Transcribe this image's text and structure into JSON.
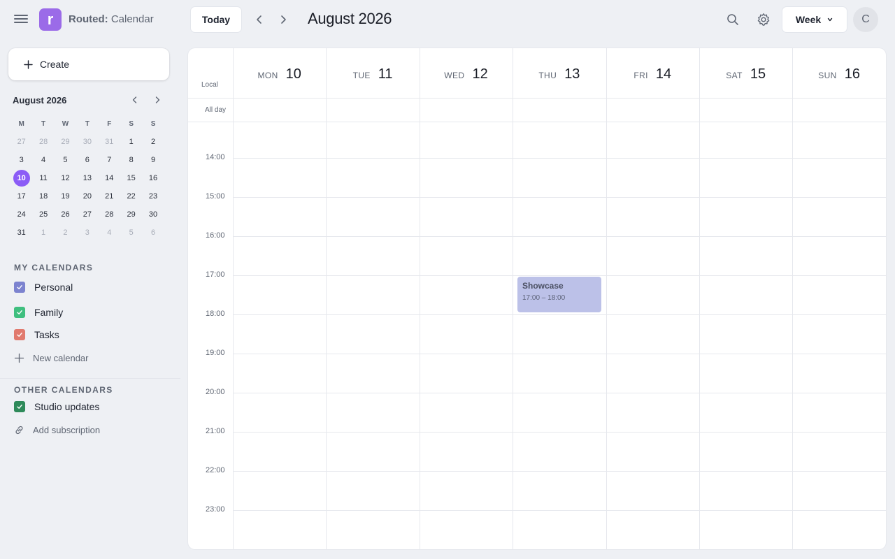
{
  "app": {
    "logo_letter": "r",
    "brand": "Routed:",
    "section": "Calendar",
    "accent_color": "#9b6be8"
  },
  "toolbar": {
    "today_label": "Today",
    "title": "August 2026",
    "view_label": "Week",
    "avatar_initial": "C"
  },
  "sidebar": {
    "create_label": "Create",
    "mini_calendar": {
      "title": "August 2026",
      "weekday_headers": [
        "M",
        "T",
        "W",
        "T",
        "F",
        "S",
        "S"
      ],
      "weeks": [
        [
          "27",
          "28",
          "29",
          "30",
          "31",
          "1",
          "2"
        ],
        [
          "3",
          "4",
          "5",
          "6",
          "7",
          "8",
          "9"
        ],
        [
          "10",
          "11",
          "12",
          "13",
          "14",
          "15",
          "16"
        ],
        [
          "17",
          "18",
          "19",
          "20",
          "21",
          "22",
          "23"
        ],
        [
          "24",
          "25",
          "26",
          "27",
          "28",
          "29",
          "30"
        ],
        [
          "31",
          "1",
          "2",
          "3",
          "4",
          "5",
          "6"
        ]
      ],
      "selected_day": "10",
      "selected_color": "#8b5cf6"
    },
    "my_calendars": {
      "title": "MY CALENDARS",
      "items": [
        {
          "label": "Personal",
          "color": "#7c83cf"
        },
        {
          "label": "Family",
          "color": "#3fbf7f"
        },
        {
          "label": "Tasks",
          "color": "#e17a6e"
        }
      ],
      "new_label": "New calendar"
    },
    "other_calendars": {
      "title": "OTHER CALENDARS",
      "items": [
        {
          "label": "Studio updates",
          "color": "#2e8a5a"
        }
      ],
      "add_label": "Add subscription"
    }
  },
  "grid": {
    "timezone_label": "Local",
    "all_day_label": "All day",
    "days": [
      {
        "weekday": "MON",
        "date": "10"
      },
      {
        "weekday": "TUE",
        "date": "11"
      },
      {
        "weekday": "WED",
        "date": "12"
      },
      {
        "weekday": "THU",
        "date": "13"
      },
      {
        "weekday": "FRI",
        "date": "14"
      },
      {
        "weekday": "SAT",
        "date": "15"
      },
      {
        "weekday": "SUN",
        "date": "16"
      }
    ],
    "hours": [
      "14:00",
      "15:00",
      "16:00",
      "17:00",
      "18:00",
      "19:00",
      "20:00",
      "21:00",
      "22:00",
      "23:00"
    ]
  },
  "events": [
    {
      "title": "Showcase",
      "time": "17:00 – 18:00",
      "day": "THU 13",
      "color": "#bcc1e8"
    }
  ]
}
